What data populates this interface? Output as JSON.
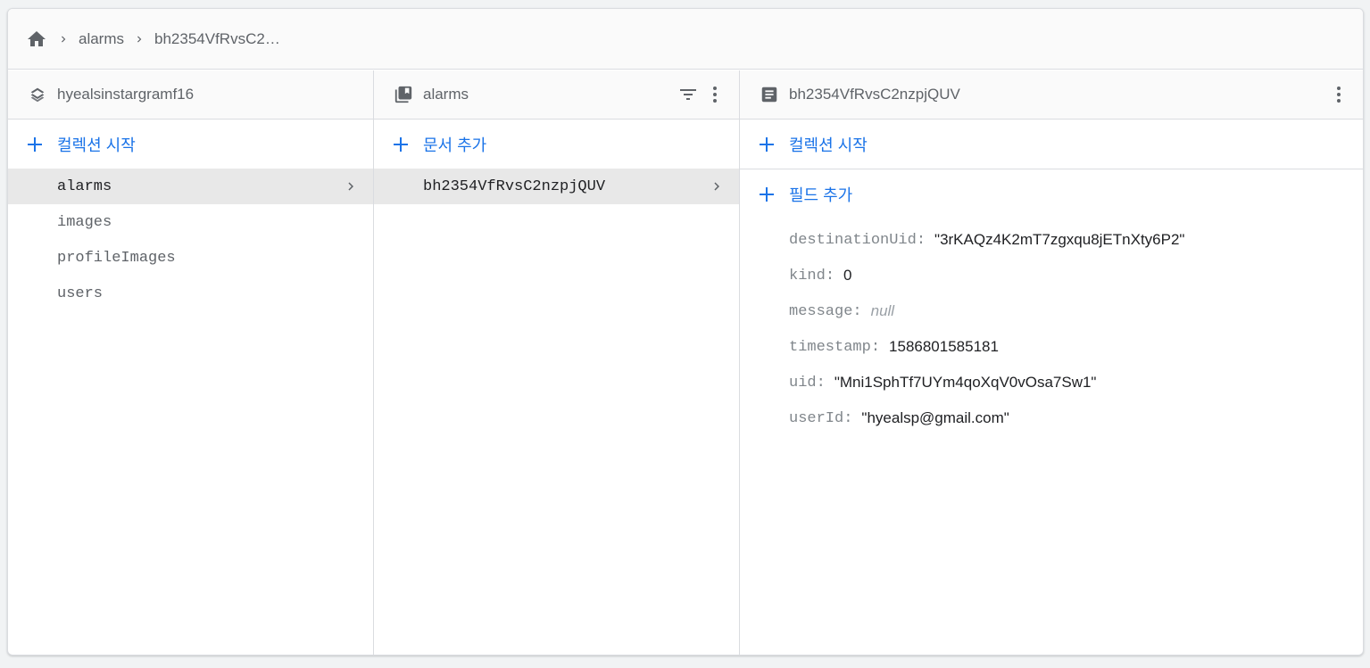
{
  "breadcrumb": {
    "home_icon": "home-icon",
    "items": [
      "alarms",
      "bh2354VfRvsC2…"
    ]
  },
  "panels": {
    "root": {
      "title": "hyealsinstargramf16",
      "icon": "database-stack-icon",
      "add_label": "컬렉션 시작",
      "collections": [
        "alarms",
        "images",
        "profileImages",
        "users"
      ],
      "selected": "alarms"
    },
    "collection": {
      "title": "alarms",
      "icon": "collection-icon",
      "add_label": "문서 추가",
      "documents": [
        "bh2354VfRvsC2nzpjQUV"
      ],
      "selected": "bh2354VfRvsC2nzpjQUV"
    },
    "document": {
      "title": "bh2354VfRvsC2nzpjQUV",
      "icon": "document-icon",
      "add_collection_label": "컬렉션 시작",
      "add_field_label": "필드 추가",
      "fields": [
        {
          "key": "destinationUid",
          "value": "\"3rKAQz4K2mT7zgxqu8jETnXty6P2\""
        },
        {
          "key": "kind",
          "value": "0"
        },
        {
          "key": "message",
          "value": "null"
        },
        {
          "key": "timestamp",
          "value": "1586801585181"
        },
        {
          "key": "uid",
          "value": "\"Mni1SphTf7UYm4qoXqV0vOsa7Sw1\""
        },
        {
          "key": "userId",
          "value": "\"hyealsp@gmail.com\""
        }
      ]
    }
  },
  "colors": {
    "accent": "#1a73e8",
    "selected_row": "#e8e8e8",
    "border": "#dadce0",
    "muted_text": "#5f6368"
  }
}
